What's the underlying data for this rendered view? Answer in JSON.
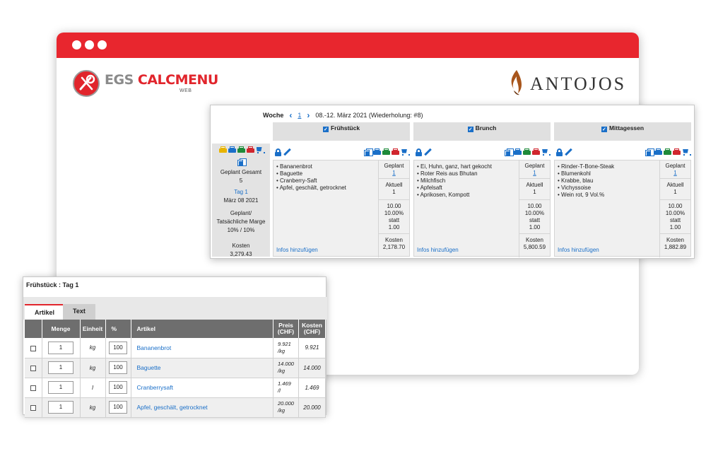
{
  "brand": {
    "part1": "EGS",
    "part2": "CALCMENU",
    "sub": "WEB"
  },
  "client": {
    "name": "ANTOJOS"
  },
  "week": {
    "label": "Woche",
    "number": "1",
    "range": "08.-12. März 2021 (Wiederholung: #8)"
  },
  "summary": {
    "planned_total_label": "Geplant Gesamt",
    "planned_total_value": "5",
    "day_link": "Tag 1",
    "date": "März 08 2021",
    "margin_label_1": "Geplant/",
    "margin_label_2": "Tatsächliche Marge",
    "margin_value": "10% / 10%",
    "cost_label": "Kosten",
    "cost_value": "3,279.43"
  },
  "meals": [
    {
      "name": "Frühstück",
      "items": [
        "Bananenbrot",
        "Baguette",
        "Cranberry-Saft",
        "Apfel, geschält, getrocknet"
      ],
      "infos_link": "Infos hinzufügen",
      "planned_label": "Geplant",
      "planned_value": "1",
      "actual_label": "Aktuell",
      "actual_value": "1",
      "price_value": "10.00",
      "margin_value": "10.00%",
      "statt_label": "statt",
      "statt_value": "1.00",
      "cost_label": "Kosten",
      "cost_value": "2,178.70"
    },
    {
      "name": "Brunch",
      "items": [
        "Ei, Huhn, ganz, hart gekocht",
        "Roter Reis aus Bhutan",
        "Milchfisch",
        "Apfelsaft",
        "Aprikosen, Kompott"
      ],
      "infos_link": "Infos hinzufügen",
      "planned_label": "Geplant",
      "planned_value": "1",
      "actual_label": "Aktuell",
      "actual_value": "1",
      "price_value": "10.00",
      "margin_value": "10.00%",
      "statt_label": "statt",
      "statt_value": "1.00",
      "cost_label": "Kosten",
      "cost_value": "5,800.59"
    },
    {
      "name": "Mittagessen",
      "items": [
        "Rinder-T-Bone-Steak",
        "Blumenkohl",
        "Krabbe, blau",
        "Vichyssoise",
        "Wein rot, 9 Vol.%"
      ],
      "infos_link": "Infos hinzufügen",
      "planned_label": "Geplant",
      "planned_value": "1",
      "actual_label": "Aktuell",
      "actual_value": "1",
      "price_value": "10.00",
      "margin_value": "10.00%",
      "statt_label": "statt",
      "statt_value": "1.00",
      "cost_label": "Kosten",
      "cost_value": "1,882.89"
    }
  ],
  "detail": {
    "title": "Frühstück : Tag 1",
    "tabs": [
      "Artikel",
      "Text"
    ],
    "columns": {
      "menge": "Menge",
      "einheit": "Einheit",
      "pct": "%",
      "artikel": "Artikel",
      "preis_1": "Preis",
      "preis_2": "(CHF)",
      "kosten_1": "Kosten",
      "kosten_2": "(CHF)"
    },
    "rows": [
      {
        "menge": "1",
        "einheit": "kg",
        "pct": "100",
        "artikel": "Bananenbrot",
        "preis": "9.921",
        "preis_unit": "/kg",
        "kosten": "9.921"
      },
      {
        "menge": "1",
        "einheit": "kg",
        "pct": "100",
        "artikel": "Baguette",
        "preis": "14.000",
        "preis_unit": "/kg",
        "kosten": "14.000"
      },
      {
        "menge": "1",
        "einheit": "l",
        "pct": "100",
        "artikel": "Cranberrysaft",
        "preis": "1.469",
        "preis_unit": "/l",
        "kosten": "1.469"
      },
      {
        "menge": "1",
        "einheit": "kg",
        "pct": "100",
        "artikel": "Apfel, geschält, getrocknet",
        "preis": "20.000",
        "preis_unit": "/kg",
        "kosten": "20.000"
      }
    ]
  },
  "colors": {
    "brand_red": "#e8262e",
    "link_blue": "#1a6fc8",
    "header_gray": "#6e6e6e"
  }
}
